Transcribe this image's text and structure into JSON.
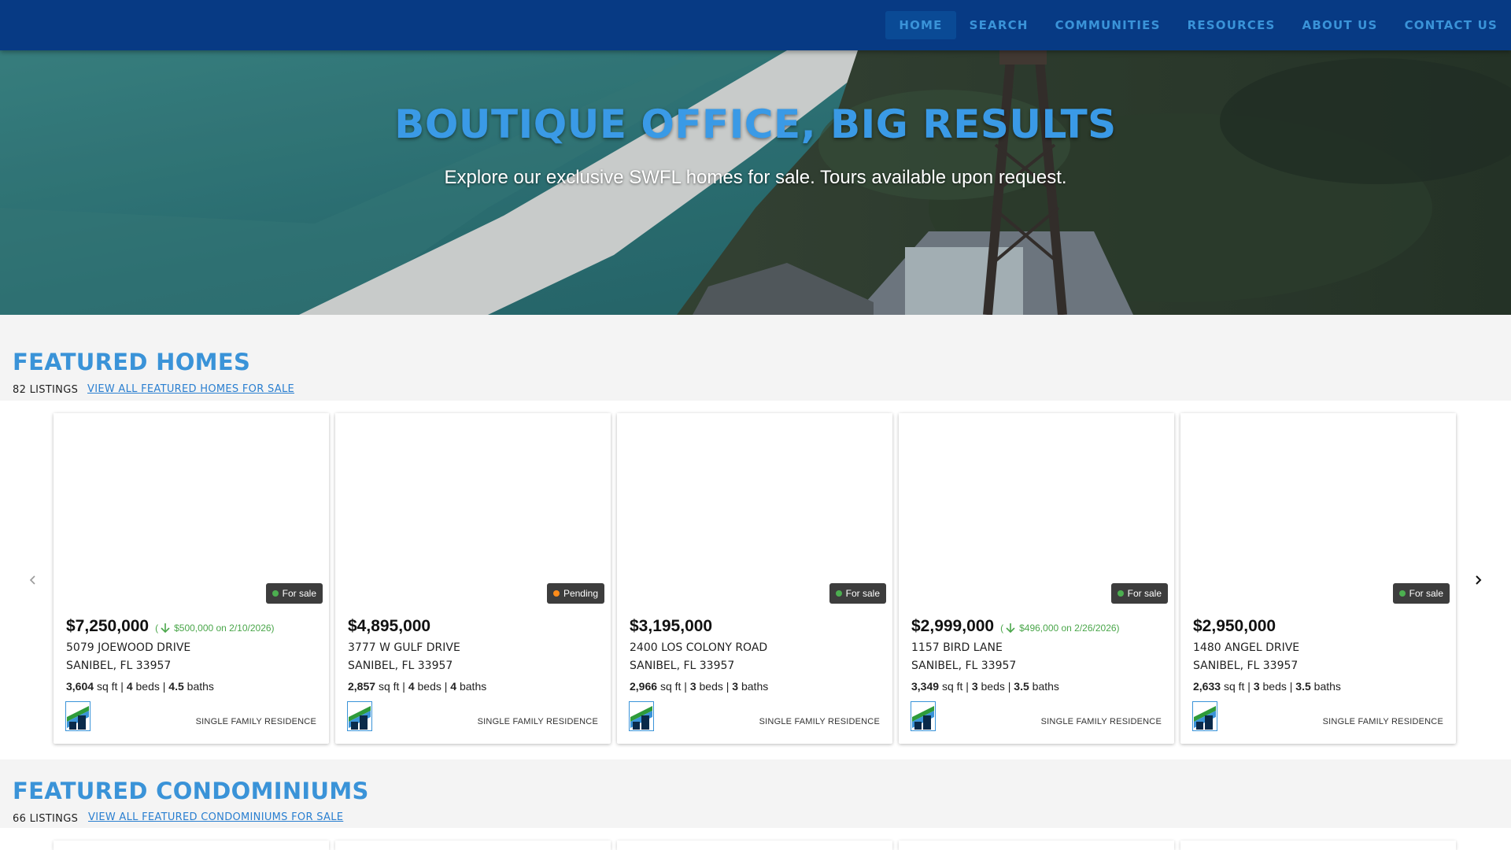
{
  "nav": {
    "items": [
      {
        "label": "HOME",
        "active": true
      },
      {
        "label": "SEARCH"
      },
      {
        "label": "COMMUNITIES"
      },
      {
        "label": "RESOURCES"
      },
      {
        "label": "ABOUT US"
      },
      {
        "label": "CONTACT US"
      }
    ]
  },
  "hero": {
    "title": "BOUTIQUE OFFICE, BIG RESULTS",
    "subtitle": "Explore our exclusive SWFL homes for sale. Tours available upon request."
  },
  "featured_homes": {
    "title": "FEATURED HOMES",
    "count": "82 LISTINGS",
    "view_all": "VIEW ALL FEATURED HOMES FOR SALE",
    "listings": [
      {
        "status": "For sale",
        "status_color": "#4caf50",
        "price": "$7,250,000",
        "drop": "$500,000 on 2/10/2026)",
        "drop_open": "(",
        "address": "5079 JOEWOOD DRIVE",
        "city": "SANIBEL, FL 33957",
        "sqft": "3,604",
        "beds": "4",
        "baths": "4.5",
        "type": "SINGLE FAMILY RESIDENCE"
      },
      {
        "status": "Pending",
        "status_color": "#ff8c1a",
        "price": "$4,895,000",
        "drop": "",
        "drop_open": "",
        "address": "3777 W GULF DRIVE",
        "city": "SANIBEL, FL 33957",
        "sqft": "2,857",
        "beds": "4",
        "baths": "4",
        "type": "SINGLE FAMILY RESIDENCE"
      },
      {
        "status": "For sale",
        "status_color": "#4caf50",
        "price": "$3,195,000",
        "drop": "",
        "drop_open": "",
        "address": "2400 LOS COLONY ROAD",
        "city": "SANIBEL, FL 33957",
        "sqft": "2,966",
        "beds": "3",
        "baths": "3",
        "type": "SINGLE FAMILY RESIDENCE"
      },
      {
        "status": "For sale",
        "status_color": "#4caf50",
        "price": "$2,999,000",
        "drop": "$496,000 on 2/26/2026)",
        "drop_open": "(",
        "address": "1157 BIRD LANE",
        "city": "SANIBEL, FL 33957",
        "sqft": "3,349",
        "beds": "3",
        "baths": "3.5",
        "type": "SINGLE FAMILY RESIDENCE"
      },
      {
        "status": "For sale",
        "status_color": "#4caf50",
        "price": "$2,950,000",
        "drop": "",
        "drop_open": "",
        "address": "1480 ANGEL DRIVE",
        "city": "SANIBEL, FL 33957",
        "sqft": "2,633",
        "beds": "3",
        "baths": "3.5",
        "type": "SINGLE FAMILY RESIDENCE"
      }
    ],
    "units": {
      "sqft": "sq ft",
      "beds": "beds",
      "baths": "baths",
      "sep": "|"
    }
  },
  "featured_condos": {
    "title": "FEATURED CONDOMINIUMS",
    "count": "66 LISTINGS",
    "view_all": "VIEW ALL FEATURED CONDOMINIUMS FOR SALE"
  },
  "icons": {
    "prev": "chevron-left-icon",
    "next": "chevron-right-icon",
    "drop": "arrow-down-icon",
    "logo": "brokerage-logo-icon"
  },
  "colors": {
    "nav_bg": "#073a84",
    "accent": "#3a93d8",
    "price_drop": "#4aa64a",
    "status_badge": "#3d3d3d"
  }
}
